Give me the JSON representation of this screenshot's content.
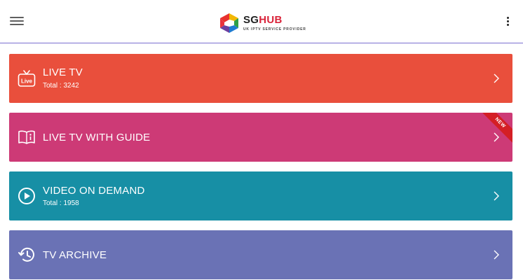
{
  "header": {
    "brand_sg": "SG",
    "brand_hub": "HUB",
    "tagline": "UK IPTV SERVICE PROVIDER"
  },
  "menu": [
    {
      "title": "LIVE TV",
      "subtitle": "Total : 3242",
      "color": "#e94f3c",
      "icon": "live-tv-icon"
    },
    {
      "title": "LIVE TV WITH GUIDE",
      "subtitle": "",
      "badge": "NEW",
      "color": "#cd3a76",
      "icon": "book-icon"
    },
    {
      "title": "VIDEO ON DEMAND",
      "subtitle": "Total : 1958",
      "color": "#178fa5",
      "icon": "play-circle-icon"
    },
    {
      "title": "TV ARCHIVE",
      "subtitle": "",
      "color": "#6a72b5",
      "icon": "history-icon"
    }
  ]
}
